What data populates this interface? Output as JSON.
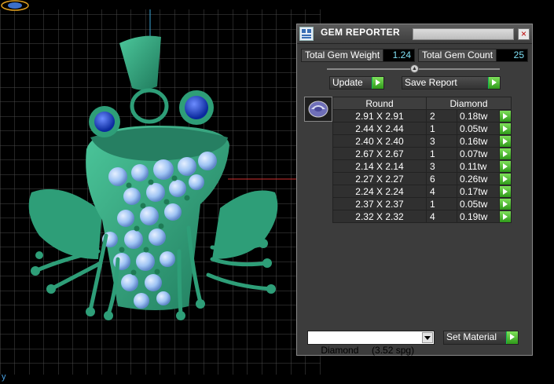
{
  "window": {
    "title": "GEM REPORTER",
    "close_glyph": "×"
  },
  "stats": {
    "weight_label": "Total Gem Weight",
    "weight_value": "1.24",
    "count_label": "Total Gem Count",
    "count_value": "25"
  },
  "toolbar": {
    "update_label": "Update",
    "save_label": "Save Report"
  },
  "table": {
    "header_shape": "Round",
    "header_material": "Diamond",
    "rows": [
      {
        "size": "2.91 X 2.91",
        "count": "2",
        "weight": "0.18tw"
      },
      {
        "size": "2.44 X 2.44",
        "count": "1",
        "weight": "0.05tw"
      },
      {
        "size": "2.40 X 2.40",
        "count": "3",
        "weight": "0.16tw"
      },
      {
        "size": "2.67 X 2.67",
        "count": "1",
        "weight": "0.07tw"
      },
      {
        "size": "2.14 X 2.14",
        "count": "3",
        "weight": "0.11tw"
      },
      {
        "size": "2.27 X 2.27",
        "count": "6",
        "weight": "0.26tw"
      },
      {
        "size": "2.24 X 2.24",
        "count": "4",
        "weight": "0.17tw"
      },
      {
        "size": "2.37 X 2.37",
        "count": "1",
        "weight": "0.05tw"
      },
      {
        "size": "2.32 X 2.32",
        "count": "4",
        "weight": "0.19tw"
      }
    ]
  },
  "material": {
    "selected": "Diamond     (3.52 spg)",
    "set_label": "Set Material"
  },
  "viewport": {
    "axis_label": "y"
  },
  "icons": {
    "go": "green-play-arrow-icon",
    "gem_thumb": "round-gem-icon",
    "app": "gem-reporter-app-icon"
  },
  "colors": {
    "model_green": "#2e9e78",
    "gem_blue": "#9fc4f4",
    "value_cyan": "#7fe0f4",
    "go_green": "#4fc030"
  }
}
